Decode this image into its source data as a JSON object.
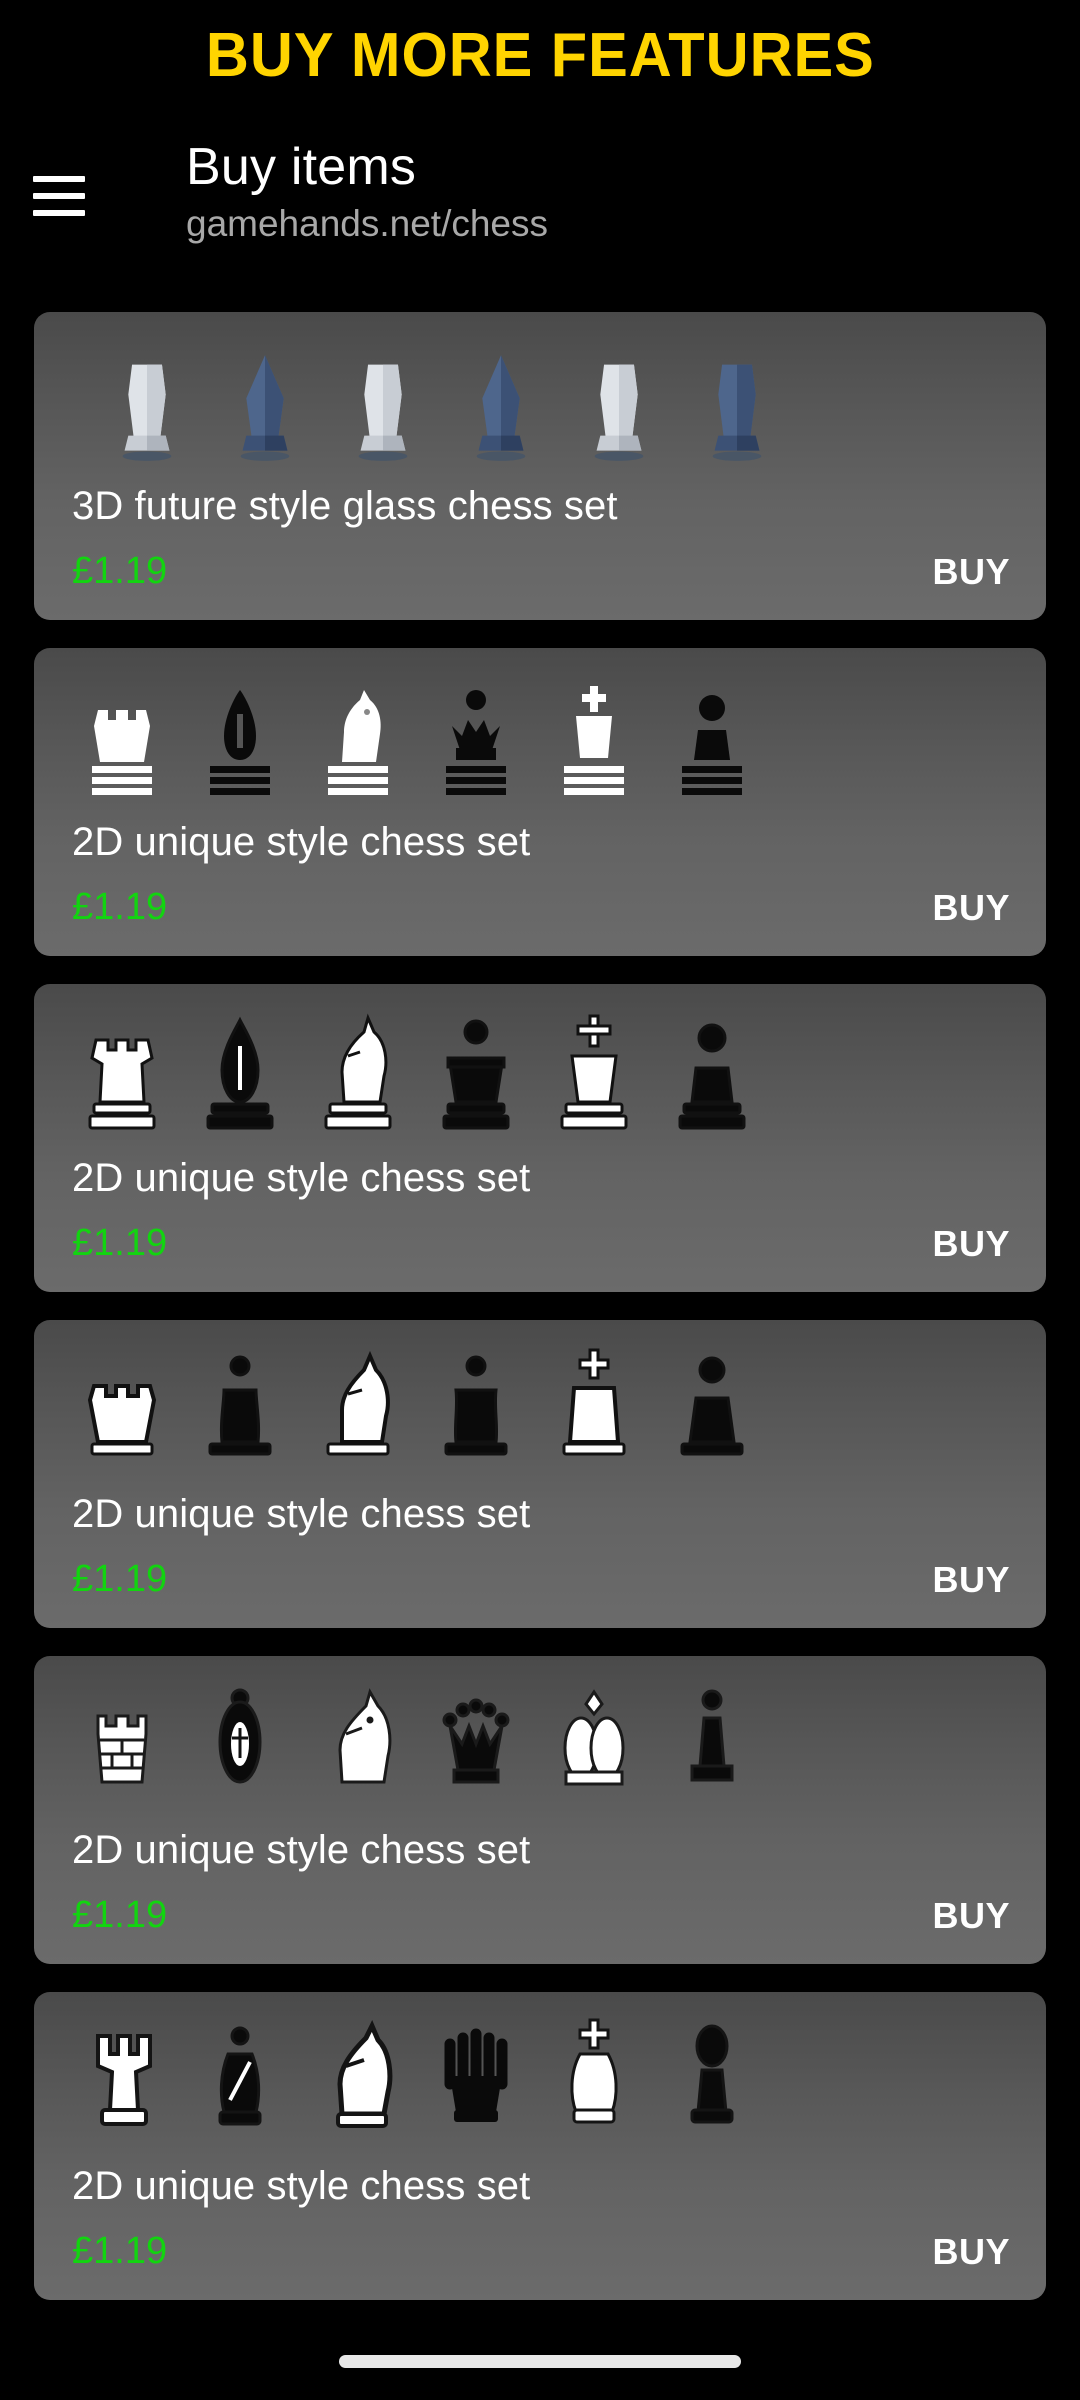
{
  "banner": {
    "text": "BUY MORE FEATURES",
    "color": "#FFD400"
  },
  "header": {
    "menu_icon": "hamburger-menu-icon",
    "title": "Buy items",
    "url": "gamehands.net/chess"
  },
  "colors": {
    "background": "#000000",
    "card_top": "#4a4a4a",
    "card_bottom": "#6b6b6b",
    "price": "#12d410",
    "accent": "#FFD400",
    "text": "#ffffff",
    "muted": "#a8a8a8"
  },
  "items": [
    {
      "title": "3D future style glass chess set",
      "price": "£1.19",
      "buy_label": "BUY",
      "style": "glass3d",
      "pieces": [
        "rook-white",
        "bishop-blue",
        "knight-white",
        "queen-blue",
        "king-white",
        "pawn-blue"
      ]
    },
    {
      "title": "2D unique style chess set",
      "price": "£1.19",
      "buy_label": "BUY",
      "style": "flat-a",
      "pieces": [
        "rook-white",
        "bishop-black",
        "knight-white",
        "queen-black",
        "king-white",
        "pawn-black"
      ]
    },
    {
      "title": "2D unique style chess set",
      "price": "£1.19",
      "buy_label": "BUY",
      "style": "flat-b",
      "pieces": [
        "rook-white",
        "bishop-black",
        "knight-white",
        "queen-black",
        "king-white",
        "pawn-black"
      ]
    },
    {
      "title": "2D unique style chess set",
      "price": "£1.19",
      "buy_label": "BUY",
      "style": "flat-c",
      "pieces": [
        "rook-white",
        "bishop-black",
        "knight-white",
        "queen-black",
        "king-white",
        "pawn-black"
      ]
    },
    {
      "title": "2D unique style chess set",
      "price": "£1.19",
      "buy_label": "BUY",
      "style": "ornate",
      "pieces": [
        "rook-white",
        "bishop-black",
        "knight-white",
        "queen-black",
        "king-white",
        "pawn-black"
      ]
    },
    {
      "title": "2D unique style chess set",
      "price": "£1.19",
      "buy_label": "BUY",
      "style": "bold",
      "pieces": [
        "rook-white",
        "bishop-black",
        "knight-white",
        "queen-black",
        "king-white",
        "pawn-black"
      ]
    }
  ],
  "system": {
    "home_indicator": "home-indicator"
  }
}
